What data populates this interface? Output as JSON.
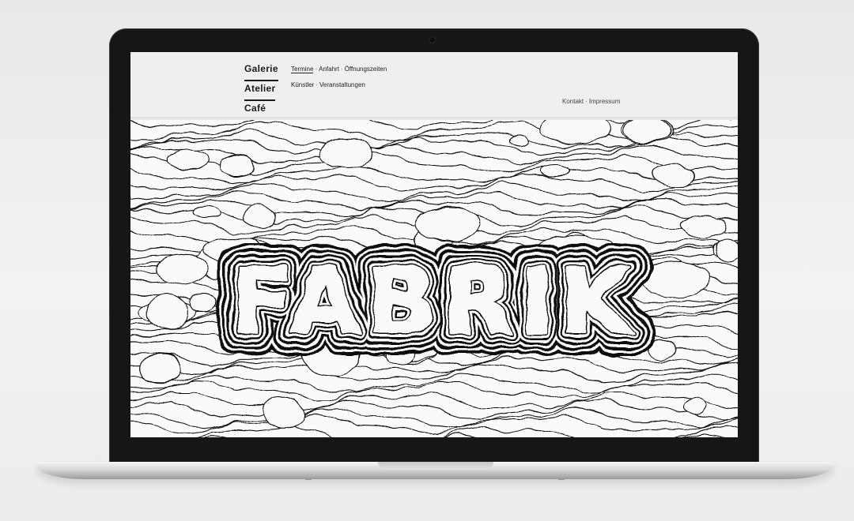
{
  "main_nav": [
    "Galerie",
    "Atelier",
    "Café"
  ],
  "sub_nav": {
    "row1": [
      "Termine",
      "Anfahrt",
      "Öffnungszeiten"
    ],
    "row2": [
      "Künstler",
      "Veranstaltungen"
    ]
  },
  "meta_nav": [
    "Kontakt",
    "Impressum"
  ],
  "hero_word": "FABRIK",
  "colors": {
    "ink": "#111111",
    "page": "#f2f2f2",
    "device": "#161616"
  }
}
